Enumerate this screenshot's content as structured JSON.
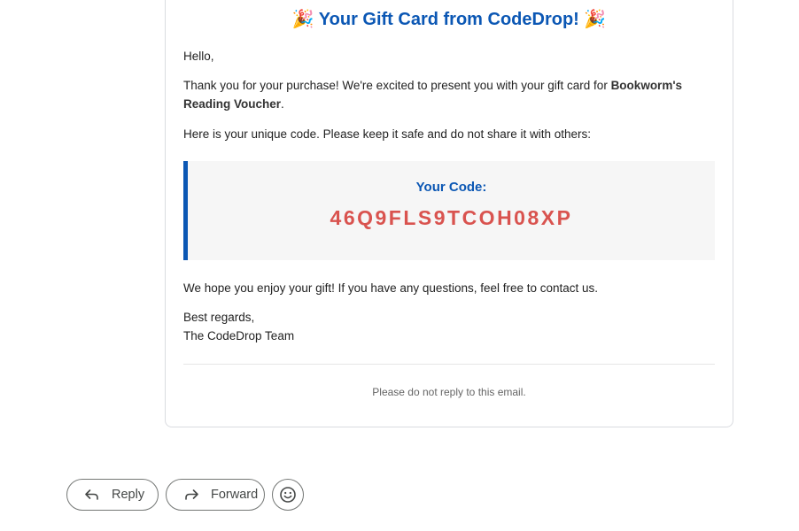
{
  "email": {
    "title_emoji": "🎉",
    "title": "Your Gift Card from CodeDrop!",
    "greeting": "Hello,",
    "thanks_text": "Thank you for your purchase! We're excited to present you with your gift card for ",
    "product_name": "Bookworm's Reading Voucher",
    "thanks_end": ".",
    "code_intro": "Here is your unique code. Please keep it safe and do not share it with others:",
    "code_label": "Your Code:",
    "code_value": "46Q9FLS9TCOH08XP",
    "enjoy_text": "We hope you enjoy your gift! If you have any questions, feel free to contact us.",
    "closing": "Best regards,",
    "signature": "The CodeDrop Team",
    "footer_note": "Please do not reply to this email."
  },
  "actions": {
    "reply_label": "Reply",
    "forward_label": "Forward",
    "reply_icon": "reply-arrow-icon",
    "forward_icon": "forward-arrow-icon",
    "emoji_icon": "smiley-icon"
  },
  "colors": {
    "accent": "#0b57b4",
    "code": "#d9534f"
  }
}
